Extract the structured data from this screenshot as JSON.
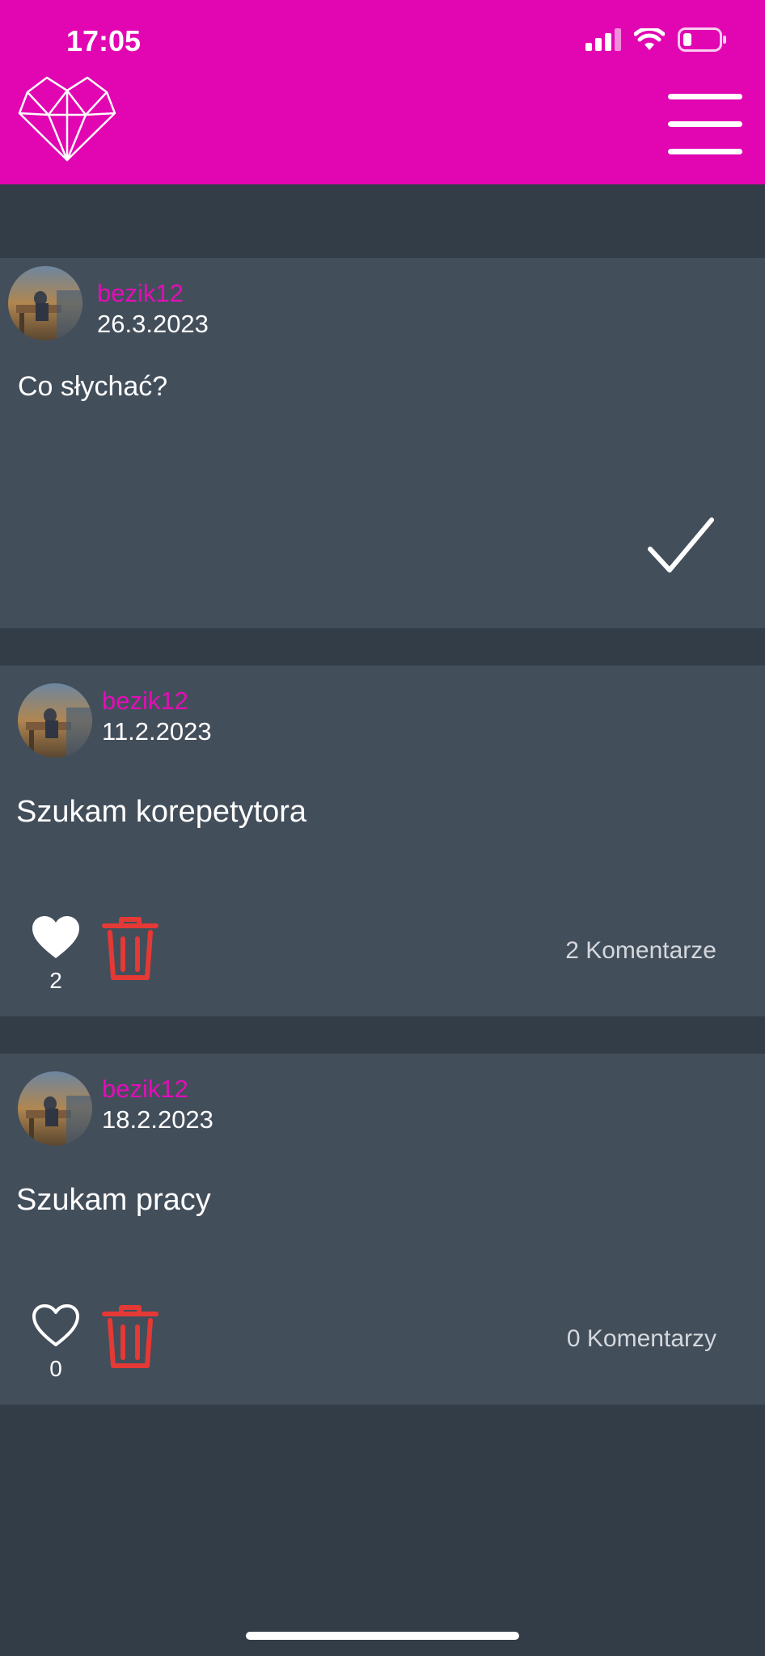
{
  "status_bar": {
    "time": "17:05"
  },
  "header": {
    "logo_icon": "geometric-heart-logo",
    "menu_icon": "hamburger-menu-icon",
    "bg_color": "#e205b2"
  },
  "posts": [
    {
      "username": "bezik12",
      "date": "26.3.2023",
      "text": "Co słychać?"
    },
    {
      "username": "bezik12",
      "date": "11.2.2023",
      "text": "Szukam korepetytora",
      "likes": "2",
      "comments": "2 Komentarze",
      "liked": true
    },
    {
      "username": "bezik12",
      "date": "18.2.2023",
      "text": "Szukam pracy",
      "likes": "0",
      "comments": "0 Komentarzy",
      "liked": false
    }
  ],
  "colors": {
    "username": "#e20eb6",
    "trash": "#e53935",
    "card": "#434e5b",
    "background": "#333d48"
  }
}
